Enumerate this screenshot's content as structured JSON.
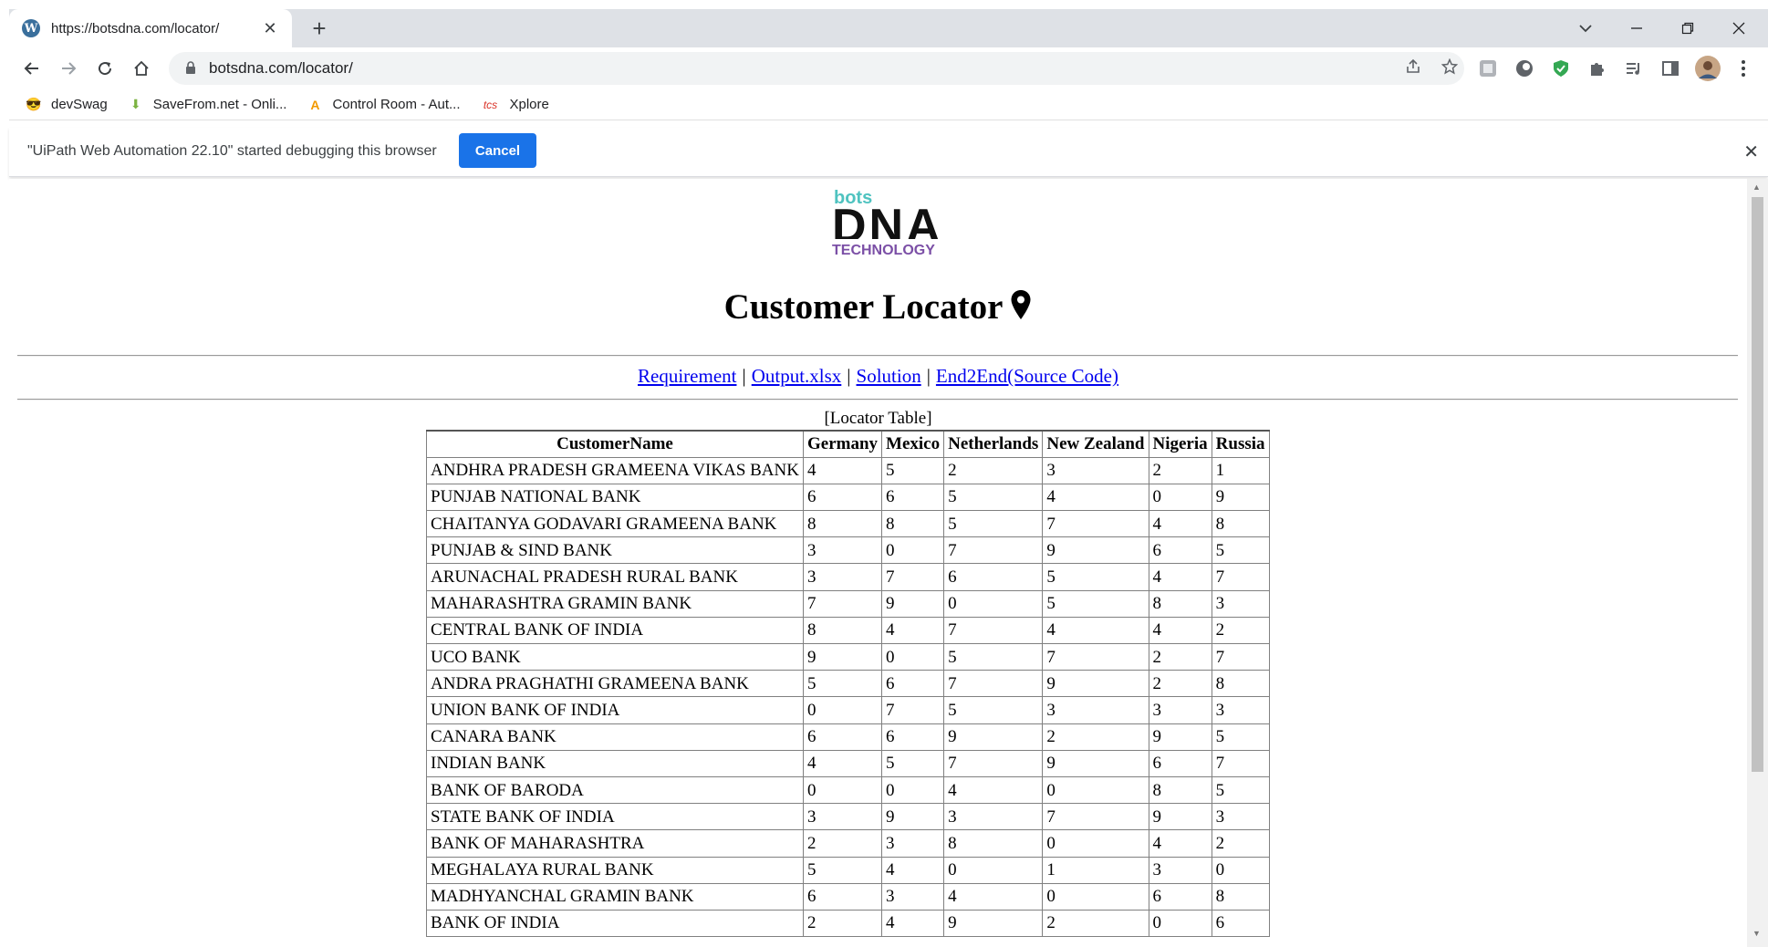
{
  "browser": {
    "tab_title": "https://botsdna.com/locator/",
    "tab_favicon": "W",
    "new_tab": "+",
    "url": "botsdna.com/locator/",
    "bookmarks": [
      {
        "label": "devSwag",
        "icon": "😎",
        "color": "#f4b400"
      },
      {
        "label": "SaveFrom.net - Onli...",
        "icon": "⬇",
        "color": "#7cb342"
      },
      {
        "label": "Control Room - Aut...",
        "icon": "A",
        "color": "#f29900"
      },
      {
        "label": "Xplore",
        "icon": "tcs",
        "color": "#d93025"
      }
    ],
    "infobar_message": "\"UiPath Web Automation 22.10\" started debugging this browser",
    "infobar_button": "Cancel"
  },
  "page": {
    "logo": {
      "top": "bots",
      "middle": "DNA",
      "bottom": "TECHNOLOGY"
    },
    "title": "Customer Locator",
    "links": [
      "Requirement",
      "Output.xlsx",
      "Solution",
      "End2End(Source Code)"
    ],
    "link_separator": "|",
    "table_caption": "[Locator Table]",
    "table": {
      "headers": [
        "CustomerName",
        "Germany",
        "Mexico",
        "Netherlands",
        "New Zealand",
        "Nigeria",
        "Russia"
      ],
      "rows": [
        [
          "ANDHRA PRADESH GRAMEENA VIKAS BANK",
          "4",
          "5",
          "2",
          "3",
          "2",
          "1"
        ],
        [
          "PUNJAB NATIONAL BANK",
          "6",
          "6",
          "5",
          "4",
          "0",
          "9"
        ],
        [
          "CHAITANYA GODAVARI GRAMEENA BANK",
          "8",
          "8",
          "5",
          "7",
          "4",
          "8"
        ],
        [
          "PUNJAB & SIND BANK",
          "3",
          "0",
          "7",
          "9",
          "6",
          "5"
        ],
        [
          "ARUNACHAL PRADESH RURAL BANK",
          "3",
          "7",
          "6",
          "5",
          "4",
          "7"
        ],
        [
          "MAHARASHTRA GRAMIN BANK",
          "7",
          "9",
          "0",
          "5",
          "8",
          "3"
        ],
        [
          "CENTRAL BANK OF INDIA",
          "8",
          "4",
          "7",
          "4",
          "4",
          "2"
        ],
        [
          "UCO BANK",
          "9",
          "0",
          "5",
          "7",
          "2",
          "7"
        ],
        [
          "ANDRA PRAGHATHI GRAMEENA BANK",
          "5",
          "6",
          "7",
          "9",
          "2",
          "8"
        ],
        [
          "UNION BANK OF INDIA",
          "0",
          "7",
          "5",
          "3",
          "3",
          "3"
        ],
        [
          "CANARA BANK",
          "6",
          "6",
          "9",
          "2",
          "9",
          "5"
        ],
        [
          "INDIAN BANK",
          "4",
          "5",
          "7",
          "9",
          "6",
          "7"
        ],
        [
          "BANK OF BARODA",
          "0",
          "0",
          "4",
          "0",
          "8",
          "5"
        ],
        [
          "STATE BANK OF INDIA",
          "3",
          "9",
          "3",
          "7",
          "9",
          "3"
        ],
        [
          "BANK OF MAHARASHTRA",
          "2",
          "3",
          "8",
          "0",
          "4",
          "2"
        ],
        [
          "MEGHALAYA RURAL BANK",
          "5",
          "4",
          "0",
          "1",
          "3",
          "0"
        ],
        [
          "MADHYANCHAL GRAMIN BANK",
          "6",
          "3",
          "4",
          "0",
          "6",
          "8"
        ],
        [
          "BANK OF INDIA",
          "2",
          "4",
          "9",
          "2",
          "0",
          "6"
        ]
      ]
    }
  }
}
